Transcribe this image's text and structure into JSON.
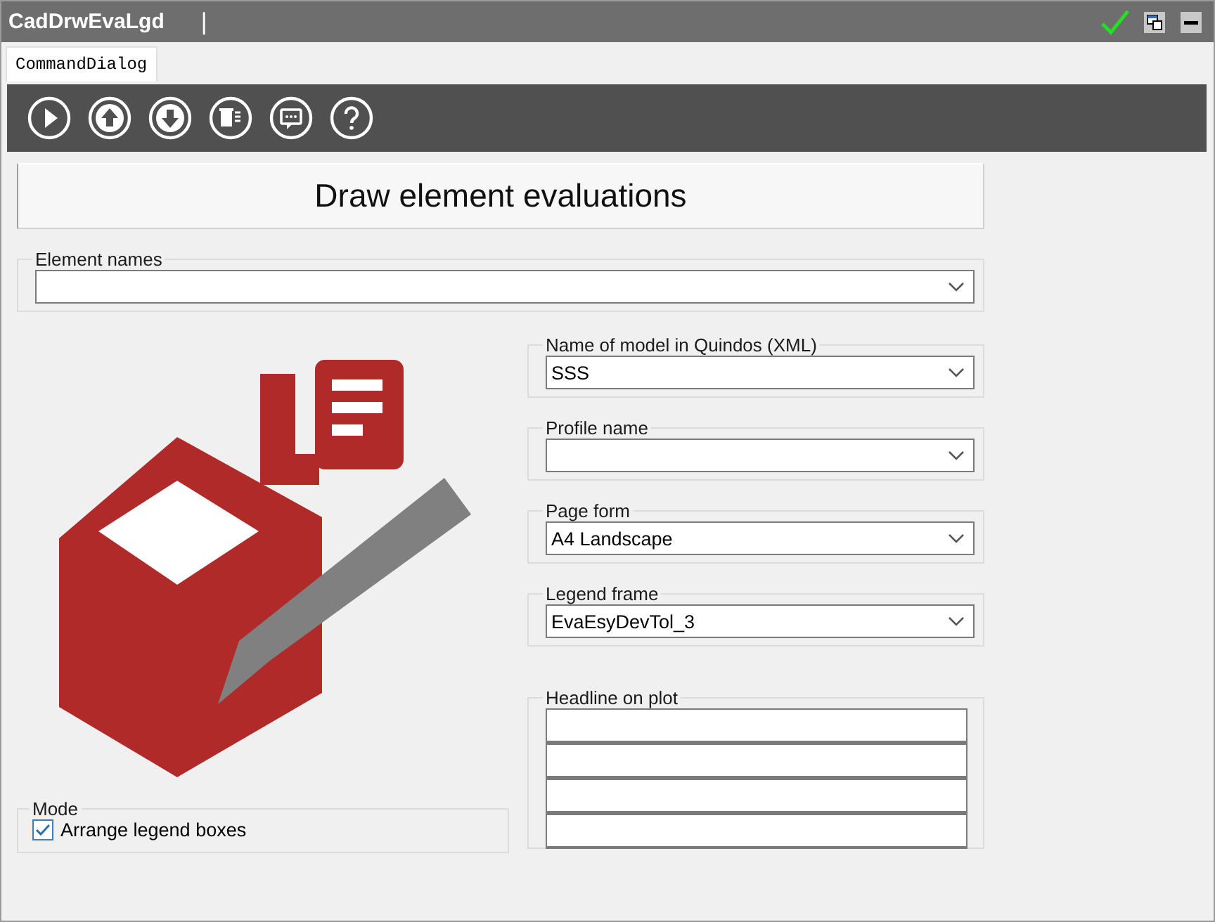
{
  "window": {
    "title": "CadDrwEvaLgd",
    "separator": "|"
  },
  "tabs": [
    {
      "label": "CommandDialog",
      "selected": true
    }
  ],
  "heading": "Draw element evaluations",
  "element_names": {
    "label": "Element names"
  },
  "fields": [
    {
      "label": "Name of model in Quindos (XML)",
      "value": "SSS"
    },
    {
      "label": "Profile name"
    },
    {
      "label": "Page form",
      "value": "A4 Landscape"
    },
    {
      "label": "Legend frame",
      "value": "EvaEsyDevTol_3"
    }
  ],
  "headline": {
    "label": "Headline on plot"
  },
  "mode": {
    "label": "Mode",
    "options": [
      {
        "label": "Arrange legend boxes",
        "checked": true
      }
    ]
  }
}
